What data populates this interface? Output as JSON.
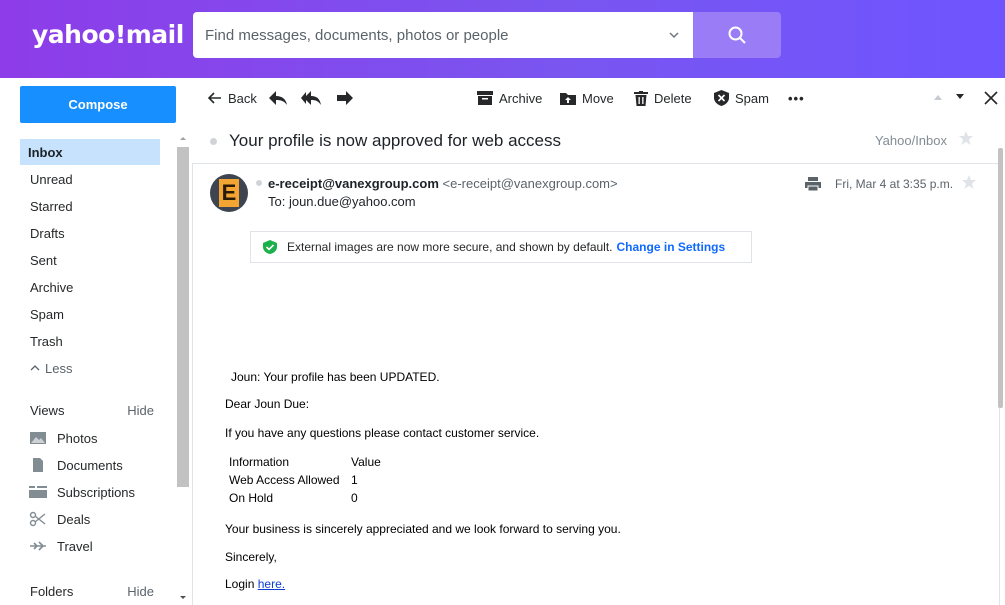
{
  "app": {
    "logo": "yahoo!mail"
  },
  "search": {
    "placeholder": "Find messages, documents, photos or people"
  },
  "sidebar": {
    "compose": "Compose",
    "folders": [
      {
        "label": "Inbox",
        "active": true
      },
      {
        "label": "Unread"
      },
      {
        "label": "Starred"
      },
      {
        "label": "Drafts"
      },
      {
        "label": "Sent"
      },
      {
        "label": "Archive"
      },
      {
        "label": "Spam"
      },
      {
        "label": "Trash"
      }
    ],
    "less": "Less",
    "views_title": "Views",
    "views_hide": "Hide",
    "views": [
      {
        "label": "Photos",
        "icon": "photos-icon"
      },
      {
        "label": "Documents",
        "icon": "documents-icon"
      },
      {
        "label": "Subscriptions",
        "icon": "subscriptions-icon"
      },
      {
        "label": "Deals",
        "icon": "deals-icon"
      },
      {
        "label": "Travel",
        "icon": "travel-icon"
      }
    ],
    "folders_title": "Folders",
    "folders_hide": "Hide"
  },
  "toolbar": {
    "back": "Back",
    "archive": "Archive",
    "move": "Move",
    "delete": "Delete",
    "spam": "Spam",
    "more": "•••"
  },
  "message": {
    "subject": "Your profile is now approved for web access",
    "folder": "Yahoo/Inbox",
    "avatar_letter": "E",
    "sender_name": "e-receipt@vanexgroup.com",
    "sender_address": "<e-receipt@vanexgroup.com>",
    "recipient": "To: joun.due@yahoo.com",
    "date": "Fri, Mar 4 at 3:35 p.m.",
    "notice_text": "External images are now more secure, and shown by default.",
    "notice_link": "Change in Settings",
    "body": {
      "line1": "Joun: Your profile has been UPDATED.",
      "greeting": "Dear Joun Due:",
      "questions": "If you have any questions please contact customer service.",
      "table": [
        [
          "Information",
          "Value"
        ],
        [
          "Web Access Allowed",
          "1"
        ],
        [
          "On Hold",
          "0"
        ]
      ],
      "appreciation": "Your business is sincerely appreciated and we look forward to serving you.",
      "closing": "Sincerely,",
      "login_prefix": "Login",
      "login_link": "here."
    }
  },
  "colors": {
    "header": "#7b4ff0",
    "compose": "#188fff",
    "active": "#c7e2fc",
    "link": "#0f69ff"
  }
}
